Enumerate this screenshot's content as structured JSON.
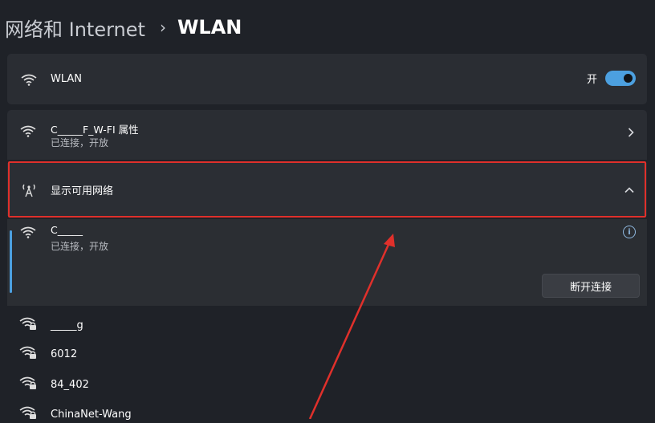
{
  "header": {
    "parent": "网络和 Internet",
    "separator": "›",
    "current": "WLAN"
  },
  "wlan_toggle": {
    "label": "WLAN",
    "state_label": "开",
    "on": true
  },
  "current_network": {
    "title": "C_____F_W-FI 属性",
    "status": "已连接，开放"
  },
  "show_networks": {
    "label": "显示可用网络",
    "expanded": true
  },
  "connected_network": {
    "name": "C_____",
    "status": "已连接，开放",
    "disconnect_label": "断开连接"
  },
  "available_networks": [
    {
      "name": "_____g"
    },
    {
      "name": "6012"
    },
    {
      "name": "84_402"
    },
    {
      "name": "ChinaNet-Wang"
    }
  ],
  "colors": {
    "accent": "#4ca0e0",
    "highlight_box": "#e0302b",
    "background": "#1f2228",
    "card": "#2a2d33"
  }
}
